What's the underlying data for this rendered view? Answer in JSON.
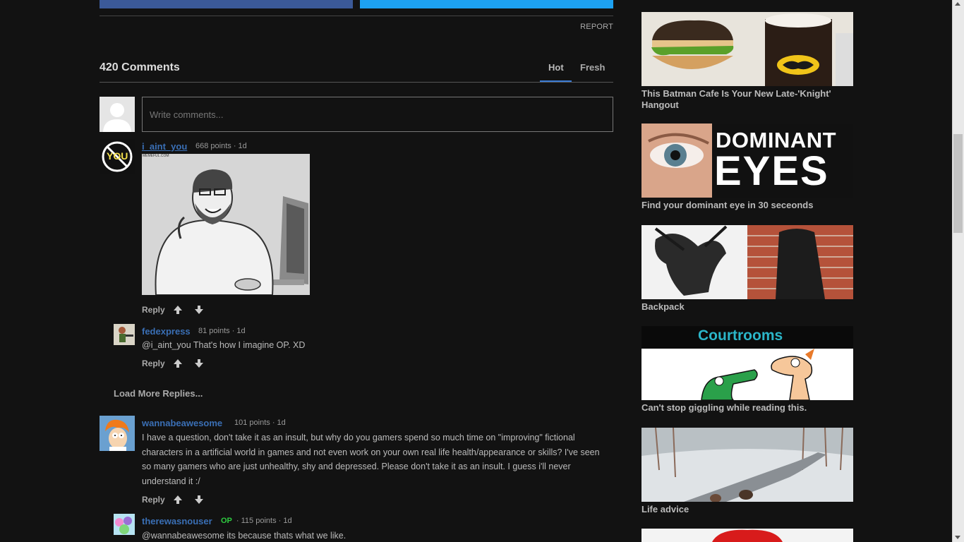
{
  "report_label": "REPORT",
  "comments": {
    "title": "420 Comments",
    "tabs": [
      {
        "label": "Hot"
      },
      {
        "label": "Fresh"
      }
    ],
    "input_placeholder": "Write comments...",
    "reply_label": "Reply",
    "load_more_label": "Load More Replies...",
    "items": [
      {
        "username": "i_aint_you",
        "meta": "668 points · 1d",
        "avatar_text": "YOU",
        "image_caption": "MEMEFUL.COM"
      },
      {
        "username": "fedexpress",
        "meta": "81 points · 1d",
        "text": "@i_aint_you That's how I imagine OP. XD"
      },
      {
        "username": "wannabeawesome",
        "meta": "101 points · 1d",
        "text": "I have a question, don't take it as an insult, but why do you gamers spend so much time on \"improving\" fictional characters in a artificial world in games and not even work on your own real life health/appearance or skills? I've seen so many gamers who are just unhealthy, shy and depressed. Please don't take it as an insult. I guess i'll never understand it :/"
      },
      {
        "username": "therewasnouser",
        "op_badge": "OP",
        "meta": "· 115 points · 1d",
        "text": "@wannabeawesome its because thats what we like."
      }
    ]
  },
  "sidebar": {
    "items": [
      {
        "title": "This Batman Cafe Is Your New Late-'Knight' Hangout"
      },
      {
        "title": "Find your dominant eye in 30 seceonds",
        "img_text_1": "DOMINANT",
        "img_text_2": "EYES"
      },
      {
        "title": "Backpack"
      },
      {
        "title": "Can't stop giggling while reading this.",
        "img_text": "Courtrooms"
      },
      {
        "title": "Life advice"
      }
    ]
  },
  "colors": {
    "background": "#121212",
    "username": "#3a6fb5",
    "op_badge": "#2ecc40",
    "tab_active": "#3a7bd5",
    "facebook": "#3b5998",
    "twitter": "#1da1f2"
  }
}
